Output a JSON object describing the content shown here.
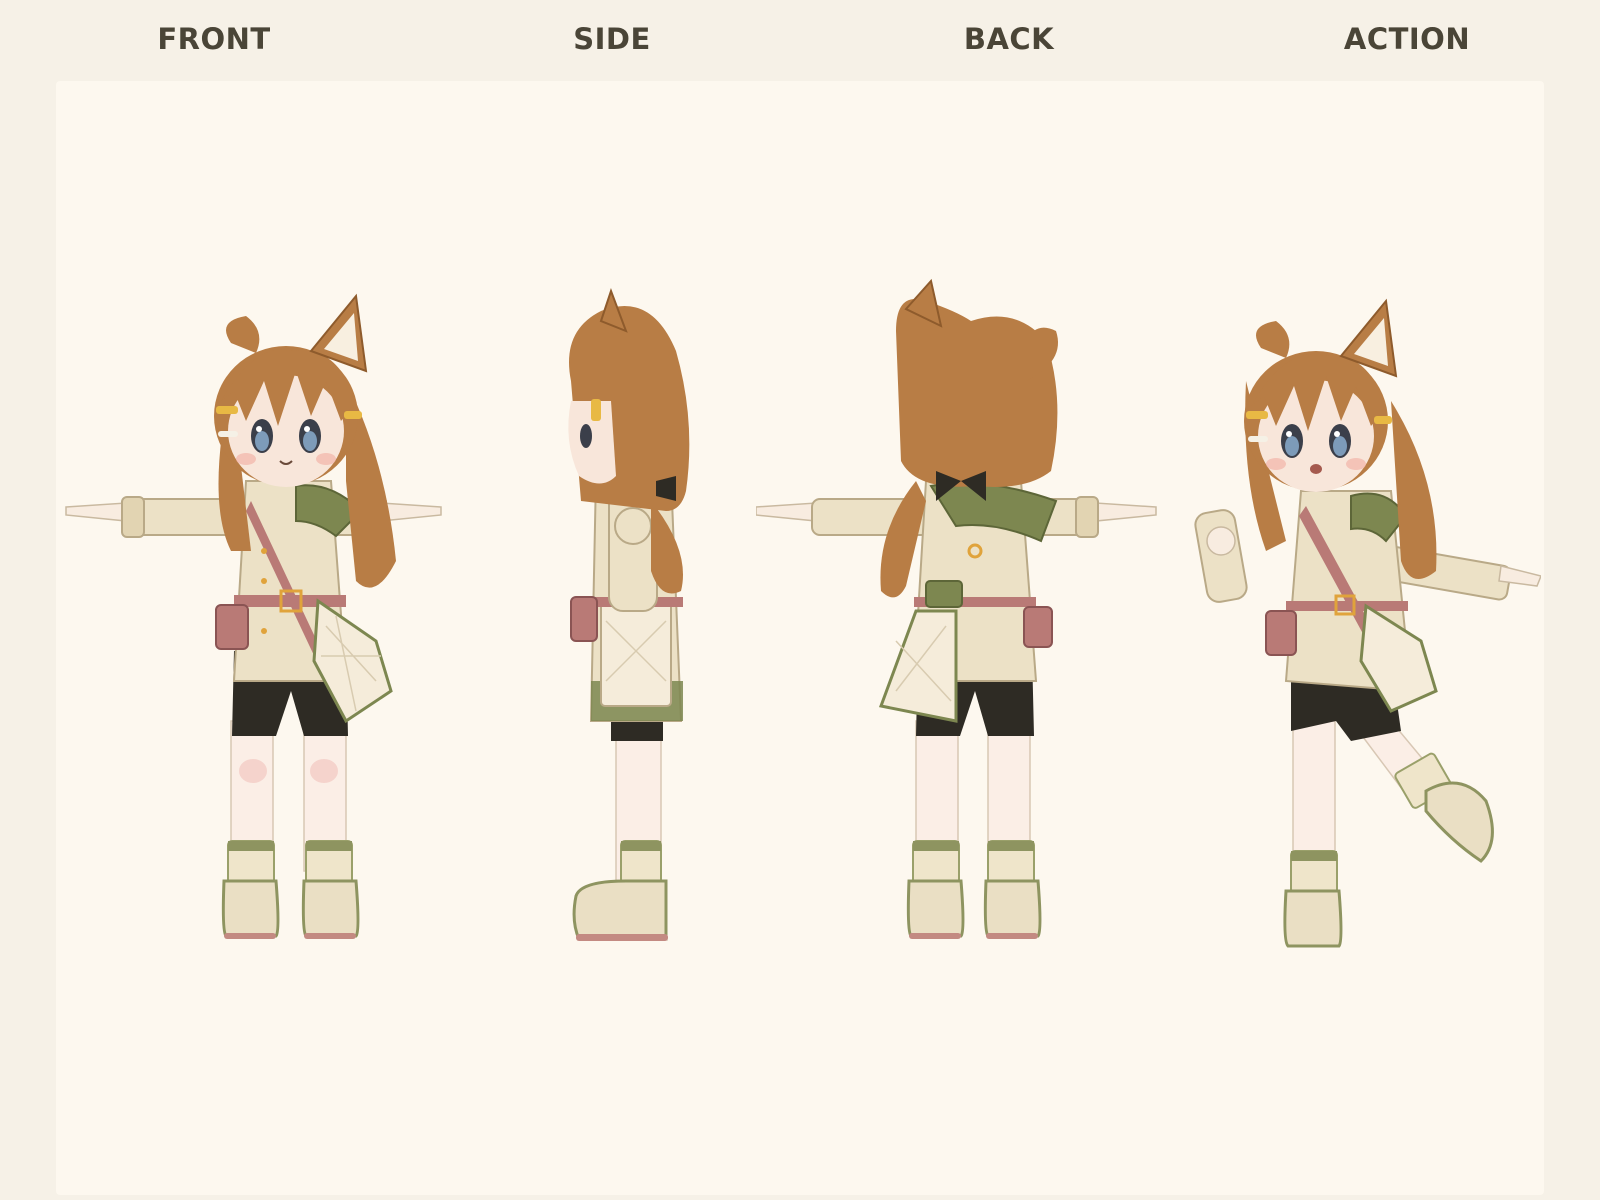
{
  "header": {
    "views": [
      "FRONT",
      "SIDE",
      "BACK",
      "ACTION"
    ]
  },
  "colors": {
    "page_background": "#f6f1e7",
    "panel_background": "#fdf8ef",
    "label_text": "#4a4537",
    "hair": "#b87d45",
    "coat": "#ece1c6",
    "capelet": "#7d8750",
    "shorts": "#2e2b24",
    "pouch": "#b97a76",
    "socks": "#efe5ca",
    "shoes": "#eadfc4"
  },
  "figures": [
    {
      "view": "front",
      "pose": "t-pose"
    },
    {
      "view": "side",
      "pose": "standing"
    },
    {
      "view": "back",
      "pose": "t-pose"
    },
    {
      "view": "action",
      "pose": "one-leg-raised"
    }
  ]
}
